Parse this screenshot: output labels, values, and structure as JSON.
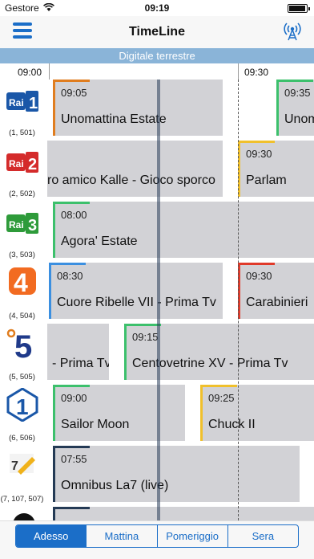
{
  "status": {
    "carrier": "Gestore",
    "time": "09:19"
  },
  "nav": {
    "title": "TimeLine",
    "menu_icon": "hamburger-menu-icon",
    "antenna_icon": "antenna-icon"
  },
  "subtitle": "Digitale terrestre",
  "times": [
    "09:00",
    "09:30"
  ],
  "colors": {
    "accent": "#1b6ec8",
    "orange": "#e07d1f",
    "green": "#3cc06c",
    "yellow": "#f0c02c",
    "red": "#e03a2a",
    "blue": "#3b8fe0",
    "navy": "#243a55"
  },
  "channels": [
    {
      "num": "(1, 501)",
      "logo": "rai1-logo",
      "logo_text": "Rai 1",
      "programs": [
        {
          "time": "09:05",
          "name": "Unomattina Estate"
        },
        {
          "time": "09:35",
          "name": "Unom"
        }
      ]
    },
    {
      "num": "(2, 502)",
      "logo": "rai2-logo",
      "logo_text": "Rai 2",
      "programs": [
        {
          "time": "",
          "name": "ro amico Kalle - Gioco sporco"
        },
        {
          "time": "09:30",
          "name": "Parlam"
        }
      ]
    },
    {
      "num": "(3, 503)",
      "logo": "rai3-logo",
      "logo_text": "Rai 3",
      "programs": [
        {
          "time": "08:00",
          "name": "Agora' Estate"
        }
      ]
    },
    {
      "num": "(4, 504)",
      "logo": "rete4-logo",
      "logo_text": "4",
      "programs": [
        {
          "time": "08:30",
          "name": "Cuore Ribelle VII - Prima Tv"
        },
        {
          "time": "09:30",
          "name": "Carabinieri"
        }
      ]
    },
    {
      "num": "(5, 505)",
      "logo": "canale5-logo",
      "logo_text": "5",
      "programs": [
        {
          "time": "",
          "name": "- Prima Tv"
        },
        {
          "time": "09:15",
          "name": "Centovetrine XV - Prima Tv"
        }
      ]
    },
    {
      "num": "(6, 506)",
      "logo": "italia1-logo",
      "logo_text": "1",
      "programs": [
        {
          "time": "09:00",
          "name": "Sailor Moon"
        },
        {
          "time": "09:25",
          "name": "Chuck II"
        }
      ]
    },
    {
      "num": "(7, 107, 507)",
      "logo": "la7-logo",
      "logo_text": "7",
      "programs": [
        {
          "time": "07:55",
          "name": "Omnibus La7 (live)"
        }
      ]
    }
  ],
  "tabs": [
    "Adesso",
    "Mattina",
    "Pomeriggio",
    "Sera"
  ]
}
